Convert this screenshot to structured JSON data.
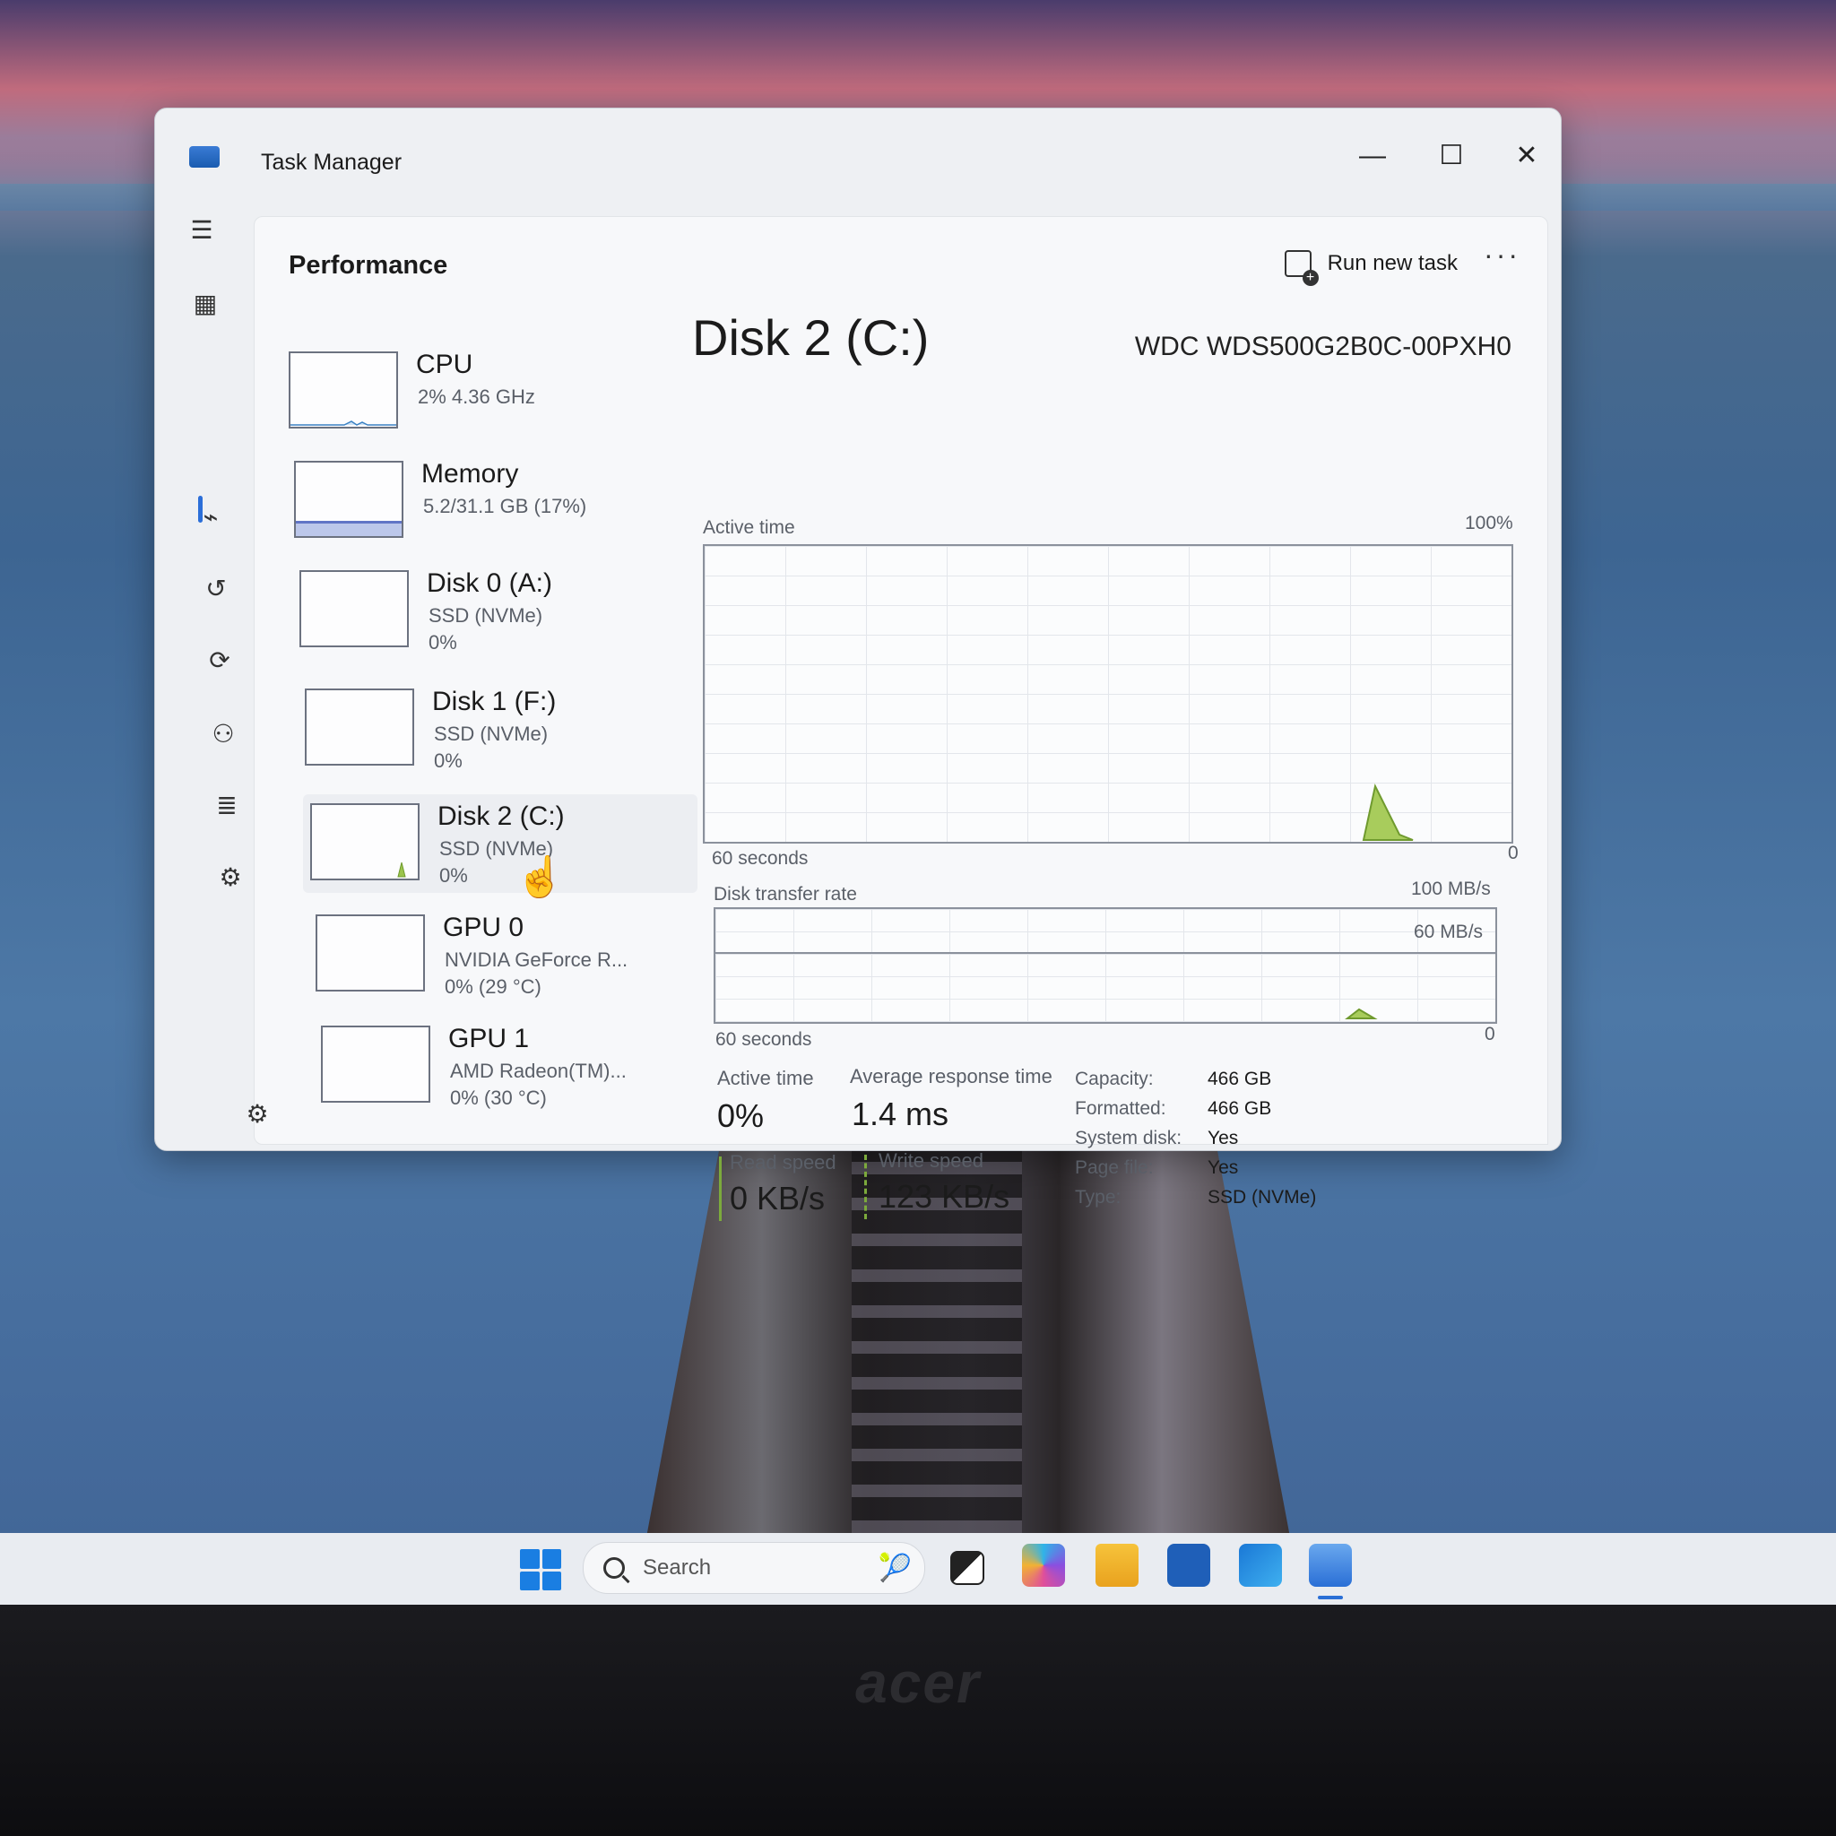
{
  "window": {
    "title": "Task Manager",
    "controls": {
      "minimize": "—",
      "maximize": "☐",
      "close": "✕"
    }
  },
  "nav": [
    {
      "name": "menu",
      "glyph": "☰"
    },
    {
      "name": "processes",
      "glyph": "▦"
    },
    {
      "name": "performance",
      "glyph": "⌁"
    },
    {
      "name": "app-history",
      "glyph": "↺"
    },
    {
      "name": "startup-apps",
      "glyph": "⟳"
    },
    {
      "name": "users",
      "glyph": "⚇"
    },
    {
      "name": "details",
      "glyph": "≣"
    },
    {
      "name": "services",
      "glyph": "⚙"
    },
    {
      "name": "settings",
      "glyph": "⚙"
    }
  ],
  "header": {
    "page_title": "Performance",
    "run_new_task": "Run new task",
    "more": "···"
  },
  "perf_list": [
    {
      "name": "CPU",
      "line1": "2% 4.36 GHz",
      "line2": ""
    },
    {
      "name": "Memory",
      "line1": "5.2/31.1 GB (17%)",
      "line2": "",
      "fill_fraction": 0.17
    },
    {
      "name": "Disk 0 (A:)",
      "line1": "SSD (NVMe)",
      "line2": "0%"
    },
    {
      "name": "Disk 1 (F:)",
      "line1": "SSD (NVMe)",
      "line2": "0%"
    },
    {
      "name": "Disk 2 (C:)",
      "line1": "SSD (NVMe)",
      "line2": "0%",
      "selected": true
    },
    {
      "name": "GPU 0",
      "line1": "NVIDIA GeForce R...",
      "line2": "0%  (29 °C)"
    },
    {
      "name": "GPU 1",
      "line1": "AMD Radeon(TM)...",
      "line2": "0%  (30 °C)"
    }
  ],
  "detail": {
    "title": "Disk 2 (C:)",
    "model": "WDC WDS500G2B0C-00PXH0",
    "active_time_graph": {
      "label": "Active time",
      "max_label": "100%",
      "time_label": "60 seconds",
      "min_label": "0"
    },
    "transfer_graph": {
      "label": "Disk transfer rate",
      "max_label": "100 MB/s",
      "limit_label": "60 MB/s",
      "time_label": "60 seconds",
      "min_label": "0"
    },
    "stats": {
      "active_time_label": "Active time",
      "active_time_value": "0%",
      "avg_response_label": "Average response time",
      "avg_response_value": "1.4 ms",
      "read_speed_label": "Read speed",
      "read_speed_value": "0 KB/s",
      "write_speed_label": "Write speed",
      "write_speed_value": "123 KB/s"
    },
    "properties": [
      {
        "key": "Capacity:",
        "value": "466 GB"
      },
      {
        "key": "Formatted:",
        "value": "466 GB"
      },
      {
        "key": "System disk:",
        "value": "Yes"
      },
      {
        "key": "Page file:",
        "value": "Yes"
      },
      {
        "key": "Type:",
        "value": "SSD (NVMe)"
      }
    ]
  },
  "taskbar": {
    "search_placeholder": "Search",
    "apps": [
      "task-view",
      "microsoft-365",
      "file-explorer",
      "microsoft-store",
      "outlook",
      "task-manager"
    ]
  },
  "brand": "acer",
  "colors": {
    "accent": "#2b6ed8",
    "disk_graph": "#7caa3c",
    "memory_graph": "#6175c6"
  }
}
